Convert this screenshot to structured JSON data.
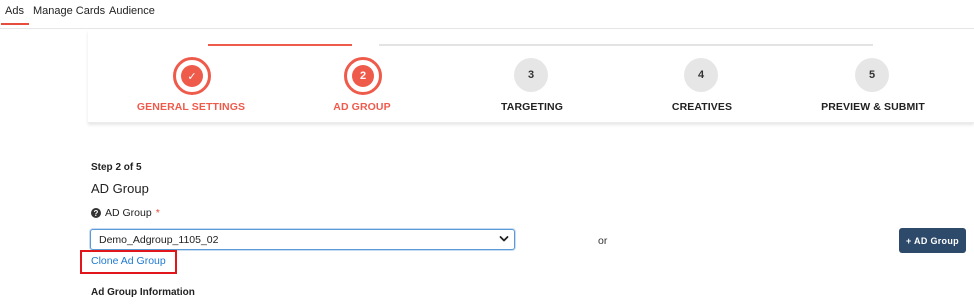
{
  "nav": {
    "tabs": [
      "Ads",
      "Manage Cards",
      "Audience"
    ]
  },
  "stepper": {
    "steps": [
      {
        "number": "✓",
        "label": "GENERAL SETTINGS",
        "state": "done"
      },
      {
        "number": "2",
        "label": "AD GROUP",
        "state": "active"
      },
      {
        "number": "3",
        "label": "TARGETING",
        "state": "todo"
      },
      {
        "number": "4",
        "label": "CREATIVES",
        "state": "todo"
      },
      {
        "number": "5",
        "label": "PREVIEW & SUBMIT",
        "state": "todo"
      }
    ]
  },
  "form": {
    "step_count": "Step 2 of 5",
    "section_title": "AD Group",
    "field_label": "AD Group",
    "required_mark": "*",
    "select_value": "Demo_Adgroup_1105_02",
    "or_text": "or",
    "add_button": "+ AD Group",
    "clone_link": "Clone Ad Group",
    "info_title": "Ad Group Information"
  },
  "colors": {
    "accent": "#ef5b4b",
    "button": "#2d4a6b",
    "link": "#1f7ad0",
    "highlight": "#e0161b"
  },
  "icons": {
    "help": "question-circle-icon",
    "dropdown": "chevron-down-icon"
  }
}
